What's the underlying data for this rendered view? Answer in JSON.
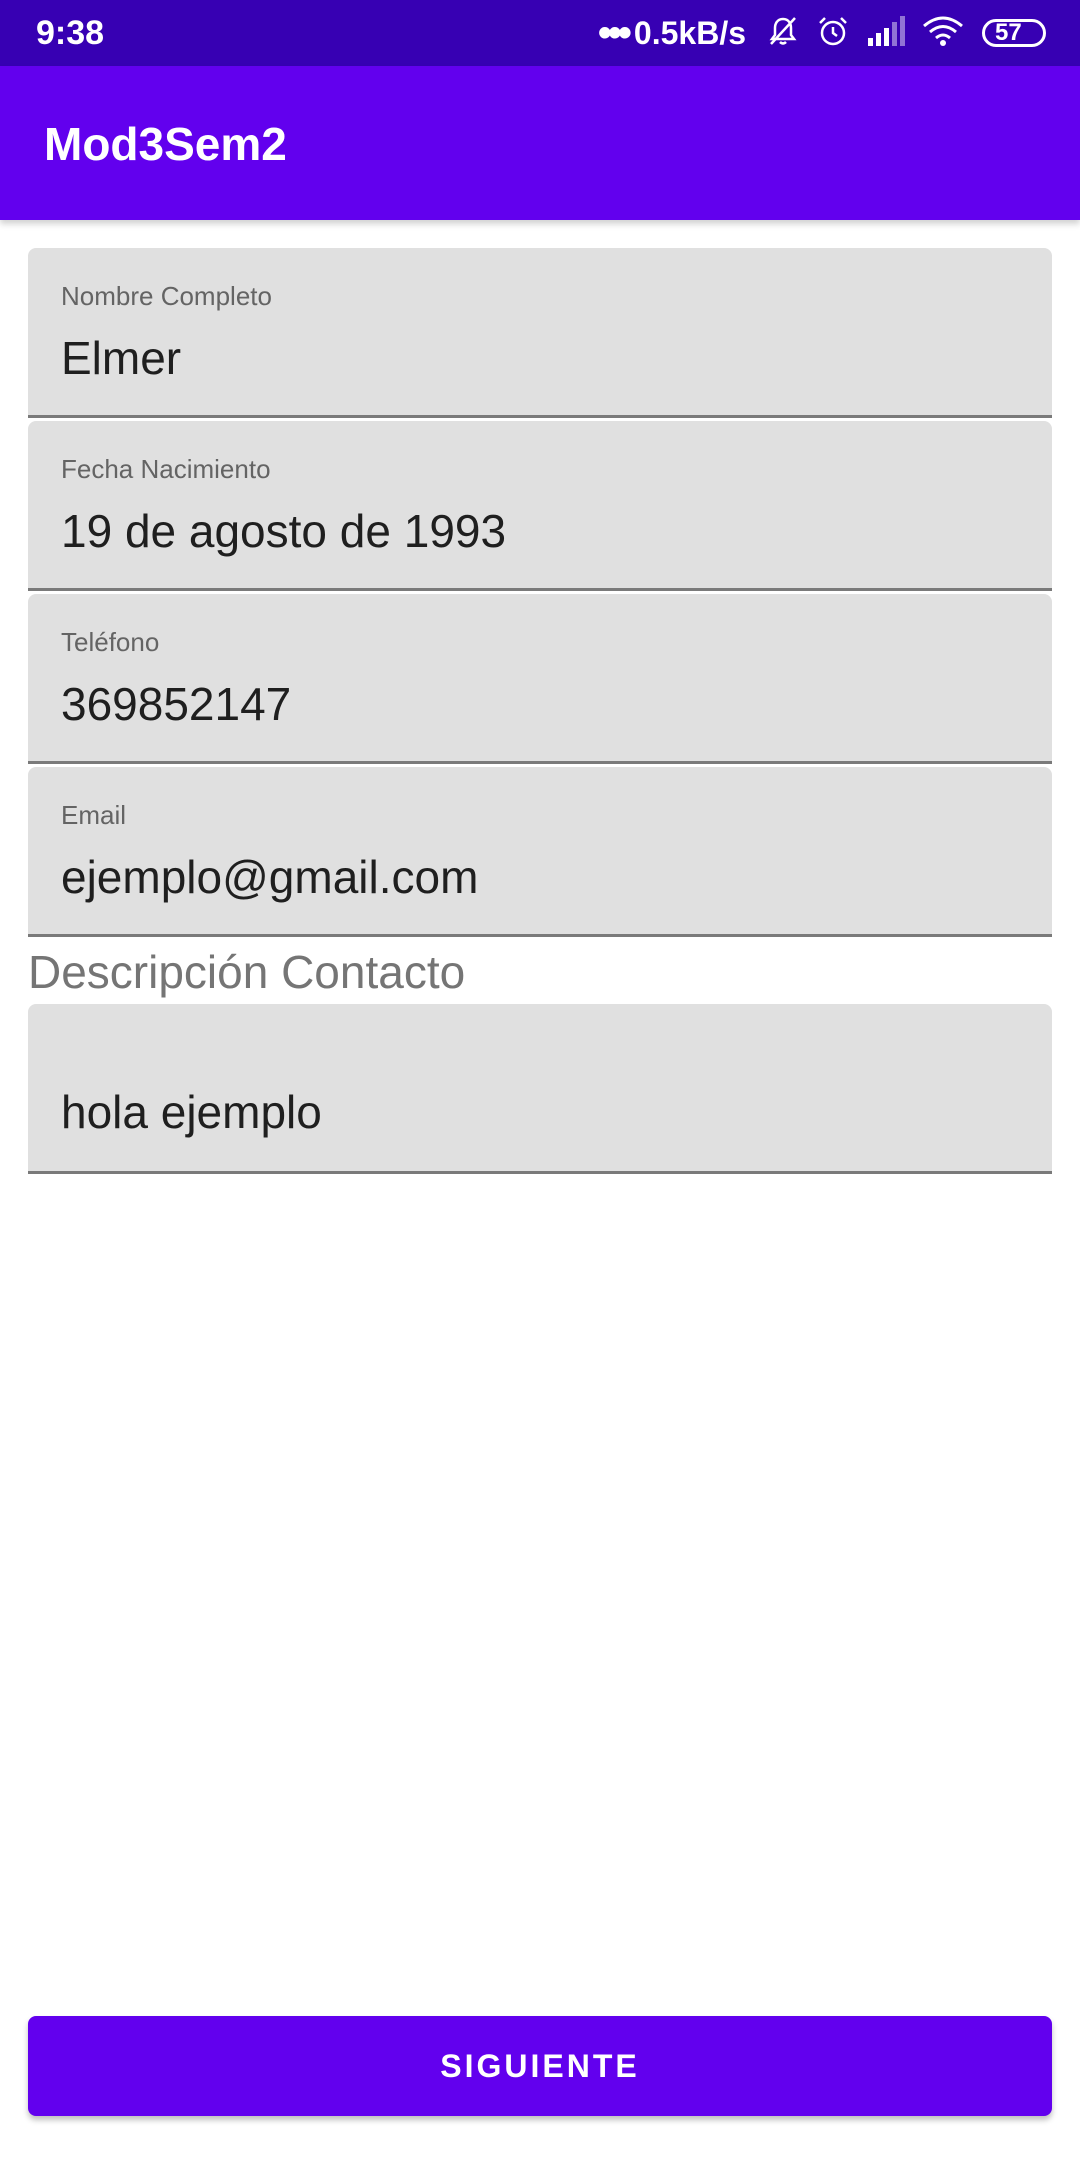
{
  "status_bar": {
    "time": "9:38",
    "dots": "•••",
    "network_speed": "0.5kB/s",
    "battery_level": "57",
    "icons": [
      "bell-muted-icon",
      "alarm-icon",
      "signal-icon",
      "wifi-icon",
      "battery-icon"
    ]
  },
  "app_bar": {
    "title": "Mod3Sem2",
    "background": "#6200ee"
  },
  "form": {
    "fields": [
      {
        "label": "Nombre Completo",
        "value": "Elmer"
      },
      {
        "label": "Fecha Nacimiento",
        "value": "19 de agosto de 1993"
      },
      {
        "label": "Teléfono",
        "value": "369852147"
      },
      {
        "label": "Email",
        "value": "ejemplo@gmail.com"
      }
    ],
    "description_label": "Descripción Contacto",
    "description_value": "hola ejemplo"
  },
  "actions": {
    "next_label": "SIGUIENTE"
  },
  "colors": {
    "primary": "#6200ee",
    "primary_dark": "#3700b3",
    "field_background": "#e0e0e0"
  }
}
